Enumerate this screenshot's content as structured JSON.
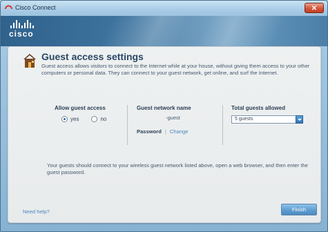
{
  "window": {
    "title": "Cisco Connect",
    "close_glyph": "✕"
  },
  "header": {
    "logo_text": "cisco"
  },
  "page": {
    "title": "Guest access settings",
    "intro": "Guest access allows visitors to connect to the Internet while at your house, without giving them access to your other computers or personal data. They can connect to your guest network, get online, and surf the Internet."
  },
  "allow_guest": {
    "label": "Allow guest access",
    "options": [
      {
        "label": "yes",
        "checked": true
      },
      {
        "label": "no",
        "checked": false
      }
    ]
  },
  "guest_network": {
    "label": "Guest network name",
    "value": "-guest",
    "password_label": "Password",
    "separator": "|",
    "change_link": "Change"
  },
  "total_guests": {
    "label": "Total guests allowed",
    "selected": "5 guests"
  },
  "footer_note": "Your guests should connect to your wireless guest network listed above, open a web browser, and then enter the guest password.",
  "help_link": "Need help?",
  "finish_button": "Finish",
  "icons": {
    "app": "cisco-app-icon",
    "house": "house-icon",
    "dropdown": "chevron-down-icon"
  },
  "colors": {
    "accent": "#2c6cb0",
    "title": "#2a4766",
    "link": "#4a86c0",
    "close": "#d5543a"
  }
}
